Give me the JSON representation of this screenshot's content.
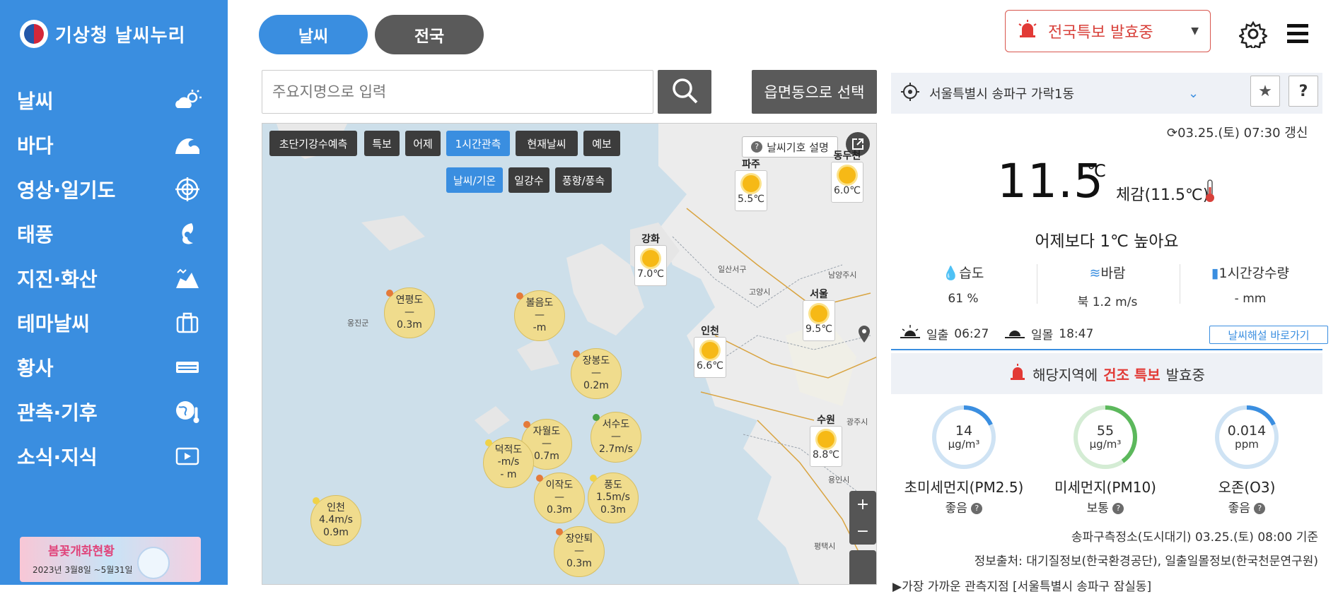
{
  "sidebar": {
    "logo_text": "기상청 날씨누리",
    "items": [
      {
        "label": "날씨",
        "icon": "cloud-sun-icon"
      },
      {
        "label": "바다",
        "icon": "wave-icon"
      },
      {
        "label": "영상·일기도",
        "icon": "radar-icon"
      },
      {
        "label": "태풍",
        "icon": "typhoon-icon"
      },
      {
        "label": "지진·화산",
        "icon": "earthquake-icon"
      },
      {
        "label": "테마날씨",
        "icon": "suitcase-icon"
      },
      {
        "label": "황사",
        "icon": "dust-icon"
      },
      {
        "label": "관측·기후",
        "icon": "globe-thermometer-icon"
      },
      {
        "label": "소식·지식",
        "icon": "play-icon"
      }
    ],
    "banner": {
      "title": "봄꽃개화현황",
      "dates": "2023년 3월8일 ~5월31일"
    }
  },
  "topbar": {
    "tab_weather": "날씨",
    "tab_nation": "전국",
    "alert_label": "전국특보 발효중"
  },
  "search": {
    "placeholder": "주요지명으로 입력",
    "dong_button": "읍면동으로 선택"
  },
  "map": {
    "tabs_row1": [
      "초단기강수예측",
      "특보",
      "어제",
      "1시간관측",
      "현재날씨",
      "예보"
    ],
    "tabs_row2": [
      "날씨/기온",
      "일강수",
      "풍향/풍속"
    ],
    "legend_label": "날씨기호 설명",
    "stations": [
      {
        "name": "파주",
        "temp": "5.5℃"
      },
      {
        "name": "동두천",
        "temp": "6.0℃"
      },
      {
        "name": "강화",
        "temp": "7.0℃"
      },
      {
        "name": "서울",
        "temp": "9.5℃"
      },
      {
        "name": "인천",
        "temp": "6.6℃"
      },
      {
        "name": "수원",
        "temp": "8.8℃"
      }
    ],
    "sea_points": [
      {
        "name": "연평도",
        "l1": "—",
        "l2": "0.3m"
      },
      {
        "name": "볼음도",
        "l1": "—",
        "l2": "-m"
      },
      {
        "name": "장봉도",
        "l1": "—",
        "l2": "0.2m"
      },
      {
        "name": "서수도",
        "l1": "—",
        "l2": "2.7m/s"
      },
      {
        "name": "자월도",
        "l1": "—",
        "l2": "0.7m"
      },
      {
        "name": "덕적도",
        "l1": "-m/s",
        "l2": "- m"
      },
      {
        "name": "풍도",
        "l1": "1.5m/s",
        "l2": "0.3m"
      },
      {
        "name": "이작도",
        "l1": "—",
        "l2": "0.3m"
      },
      {
        "name": "인천",
        "l1": "4.4m/s",
        "l2": "0.9m"
      },
      {
        "name": "장안퇴",
        "l1": "—",
        "l2": "0.3m"
      }
    ],
    "places": [
      "옹진군",
      "일산서구",
      "고양시",
      "남양주시",
      "광주시",
      "용인시",
      "평택시"
    ]
  },
  "location": {
    "address": "서울특별시 송파구 가락1동"
  },
  "current": {
    "updated": "03.25.(토) 07:30 갱신",
    "temp": "11.5",
    "unit": "℃",
    "feels": "체감(11.5℃)",
    "compare": "어제보다 1℃ 높아요",
    "humidity_label": "습도",
    "humidity_value": "61 %",
    "wind_label": "바람",
    "wind_value": "북 1.2 m/s",
    "rain_label": "1시간강수량",
    "rain_value": "- mm",
    "sunrise_label": "일출",
    "sunrise": "06:27",
    "sunset_label": "일몰",
    "sunset": "18:47",
    "commentary": "날씨해설 바로가기"
  },
  "warning": {
    "prefix": "해당지역에",
    "highlight": "건조 특보",
    "suffix": "발효중"
  },
  "air": [
    {
      "value": "14",
      "unit": "μg/m³",
      "name": "초미세먼지(PM2.5)",
      "level": "좋음",
      "color": "#3a8ee0",
      "fraction": 0.18
    },
    {
      "value": "55",
      "unit": "μg/m³",
      "name": "미세먼지(PM10)",
      "level": "보통",
      "color": "#5cb85c",
      "fraction": 0.4
    },
    {
      "value": "0.014",
      "unit": "ppm",
      "name": "오존(O3)",
      "level": "좋음",
      "color": "#3a8ee0",
      "fraction": 0.18
    }
  ],
  "notes": {
    "station": "송파구측정소(도시대기) 03.25.(토) 08:00 기준",
    "source": "정보출처: 대기질정보(한국환경공단), 일출일몰정보(한국천문연구원)",
    "nearest": "▶가장 가까운 관측지점 [서울특별시 송파구 잠실동]"
  },
  "colors": {
    "accent": "#3a8ee0",
    "alert": "#e23a36",
    "dark_button": "#5a5a5a"
  }
}
